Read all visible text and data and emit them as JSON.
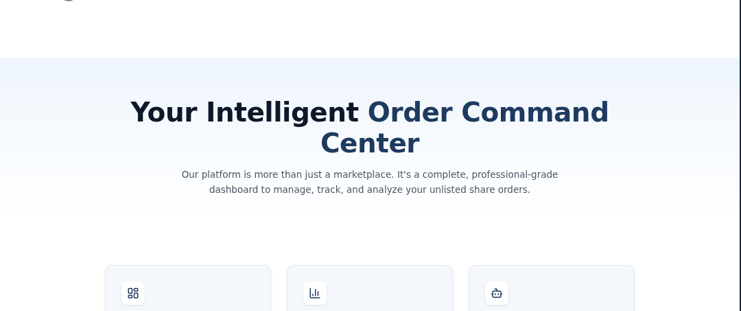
{
  "hero": {
    "title": "Your Intelligent ",
    "title_highlight": "Order Command Center",
    "subtitle": "Our platform is more than just a marketplace. It's a complete, professional-grade dashboard to manage, track, and analyze your unlisted share orders."
  },
  "features": [
    {
      "kind": "dashboard"
    },
    {
      "kind": "chart"
    },
    {
      "kind": "bot"
    }
  ]
}
